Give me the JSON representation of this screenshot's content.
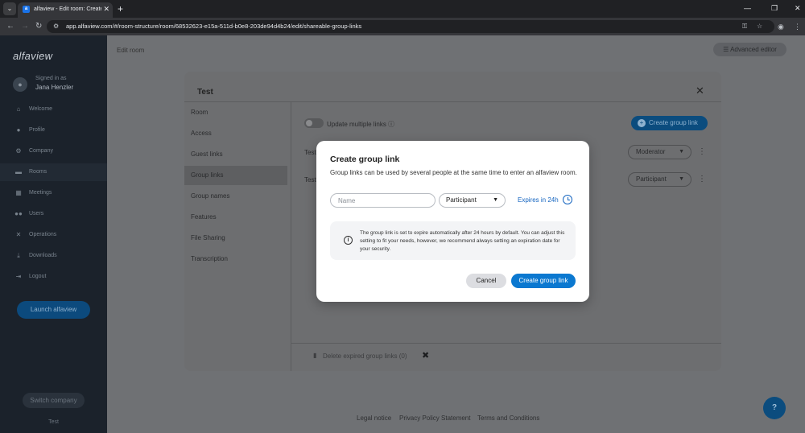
{
  "browser": {
    "tab_title": "alfaview - Edit room: Create gro",
    "url": "app.alfaview.com/#/room-structure/room/68532623-e15a-511d-b0e8-203de94d4b24/edit/shareable-group-links"
  },
  "sidebar": {
    "brand": "alfaview",
    "signed_in_label": "Signed in as",
    "user_name": "Jana Henzler",
    "items": [
      {
        "label": "Welcome",
        "icon": "home-icon"
      },
      {
        "label": "Profile",
        "icon": "user-icon"
      },
      {
        "label": "Company",
        "icon": "gear-icon"
      },
      {
        "label": "Rooms",
        "icon": "folder-icon"
      },
      {
        "label": "Meetings",
        "icon": "calendar-icon"
      },
      {
        "label": "Users",
        "icon": "users-icon"
      },
      {
        "label": "Operations",
        "icon": "tools-icon"
      },
      {
        "label": "Downloads",
        "icon": "download-icon"
      },
      {
        "label": "Logout",
        "icon": "logout-icon"
      }
    ],
    "active_item": "Rooms",
    "launch_label": "Launch alfaview",
    "switch_label": "Switch company",
    "footer_label": "Test"
  },
  "main": {
    "title": "Edit room",
    "advanced_editor": "Advanced editor",
    "footer_links": [
      "Legal notice",
      "Privacy Policy Statement",
      "Terms and Conditions"
    ]
  },
  "edit_modal": {
    "title": "Test",
    "nav": [
      "Room",
      "Access",
      "Guest links",
      "Group links",
      "Group names",
      "Features",
      "File Sharing",
      "Transcription"
    ],
    "active_nav": "Group links",
    "update_multiple": "Update multiple links",
    "create_button": "Create group link",
    "rows": [
      {
        "name": "Test",
        "role": "Moderator"
      },
      {
        "name": "Test",
        "role": "Participant"
      }
    ],
    "delete_expired": "Delete expired group links (0)"
  },
  "dialog": {
    "title": "Create group link",
    "description": "Group links can be used by several people at the same time to enter an alfaview room.",
    "name_placeholder": "Name",
    "name_value": "",
    "role_value": "Participant",
    "expires_label": "Expires in 24h",
    "info_text": "The group link is set to expire automatically after 24 hours by default. You can adjust this setting to fit your needs, however, we recommend always setting an expiration date for your security.",
    "cancel_label": "Cancel",
    "create_label": "Create group link"
  }
}
